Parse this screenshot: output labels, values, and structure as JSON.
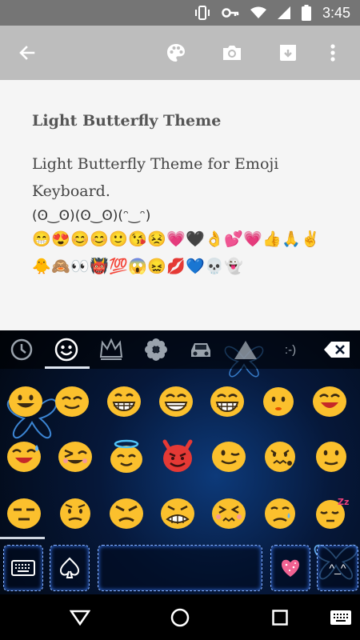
{
  "status_bar": {
    "time": "3:45",
    "icons": [
      "vibrate-icon",
      "key-icon",
      "wifi-icon",
      "signal-icon",
      "battery-icon"
    ]
  },
  "app_bar": {
    "icons": [
      "back-arrow-icon",
      "palette-icon",
      "camera-icon",
      "download-icon",
      "more-vert-icon"
    ],
    "background": "#bdbdbd"
  },
  "content": {
    "title": "Light Butterfly Theme",
    "body": "Light Butterfly Theme for Emoji Keyboard.",
    "kaomoji": "(ʘ‿ʘ)(ʘ‿ʘ)(ᵔ‿ᵔ)",
    "emoji_row1": [
      "😁",
      "😍",
      "😊",
      "😊",
      "🙂",
      "😘",
      "😣",
      "💗",
      "🖤",
      "👌",
      "💕",
      "💗",
      "👍",
      "🙏",
      "✌"
    ],
    "emoji_row2": [
      "🐥",
      "🙈",
      "👀",
      "👹",
      "💯",
      "😱",
      "😖",
      "💋",
      "💙",
      "💀",
      "👻"
    ]
  },
  "keyboard": {
    "categories": [
      "recent-clock-icon",
      "smiley-icon",
      "crown-icon",
      "flower-icon",
      "car-icon",
      "triangle-icon",
      "emoticon-text",
      "backspace-icon"
    ],
    "emoticon_label": ":-)",
    "selected_category": "smiley-icon",
    "accent": "#3a7dff",
    "bottom_keys": {
      "keyboard_label": "",
      "spade_label": "",
      "space_label": "",
      "kaomoji_label": "^_^"
    }
  },
  "nav_bar": {
    "icons": [
      "back-triangle-icon",
      "home-circle-icon",
      "recents-square-icon",
      "keyboard-switch-icon"
    ]
  }
}
